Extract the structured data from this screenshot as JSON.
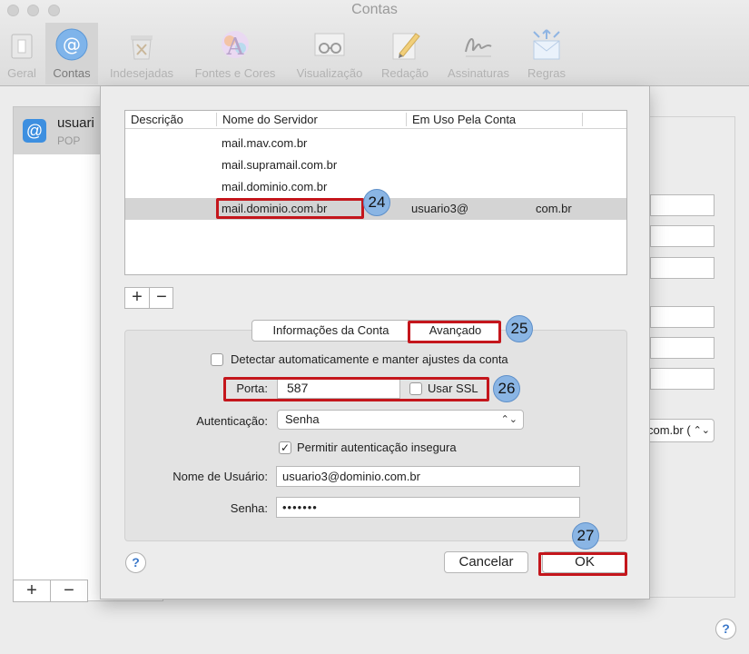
{
  "window": {
    "title": "Contas"
  },
  "toolbar": {
    "items": [
      {
        "label": "Geral",
        "icon": "switch-icon"
      },
      {
        "label": "Contas",
        "icon": "at-sign-icon"
      },
      {
        "label": "Indesejadas",
        "icon": "trash-icon"
      },
      {
        "label": "Fontes e Cores",
        "icon": "fonts-colors-icon"
      },
      {
        "label": "Visualização",
        "icon": "glasses-icon"
      },
      {
        "label": "Redação",
        "icon": "pencil-icon"
      },
      {
        "label": "Assinaturas",
        "icon": "signature-icon"
      },
      {
        "label": "Regras",
        "icon": "rules-icon"
      }
    ]
  },
  "account_list": {
    "name": "usuari",
    "type": "POP",
    "add_label": "+",
    "remove_label": "−"
  },
  "background": {
    "smtp_select": "com.br (",
    "help_label": "?"
  },
  "server_table": {
    "columns": [
      "Descrição",
      "Nome do Servidor",
      "Em Uso Pela Conta"
    ],
    "rows": [
      {
        "description": "",
        "server": "mail.mav.com.br",
        "account": ""
      },
      {
        "description": "",
        "server": "mail.supramail.com.br",
        "account": ""
      },
      {
        "description": "",
        "server": "mail.dominio.com.br",
        "account": ""
      },
      {
        "description": "",
        "server": "mail.dominio.com.br",
        "account_prefix": "usuario3@",
        "account_suffix": "com.br"
      }
    ],
    "add_label": "+",
    "remove_label": "−"
  },
  "tabs": {
    "info": "Informações da Conta",
    "advanced": "Avançado"
  },
  "form": {
    "auto_detect_label": "Detectar automaticamente e manter ajustes da conta",
    "auto_detect_checked": false,
    "port_label": "Porta:",
    "port_value": "587",
    "ssl_label": "Usar SSL",
    "ssl_checked": false,
    "auth_label": "Autenticação:",
    "auth_value": "Senha",
    "insecure_label": "Permitir autenticação insegura",
    "insecure_checked": true,
    "check_mark": "✓",
    "username_label": "Nome de Usuário:",
    "username_value": "usuario3@dominio.com.br",
    "password_label": "Senha:",
    "password_value": "•••••••"
  },
  "buttons": {
    "help": "?",
    "cancel": "Cancelar",
    "ok": "OK"
  },
  "annotations": [
    "24",
    "25",
    "26",
    "27"
  ],
  "colors": {
    "highlight": "#c4161c",
    "badge": "#8ab5e4",
    "accent": "#3d8fe0"
  }
}
